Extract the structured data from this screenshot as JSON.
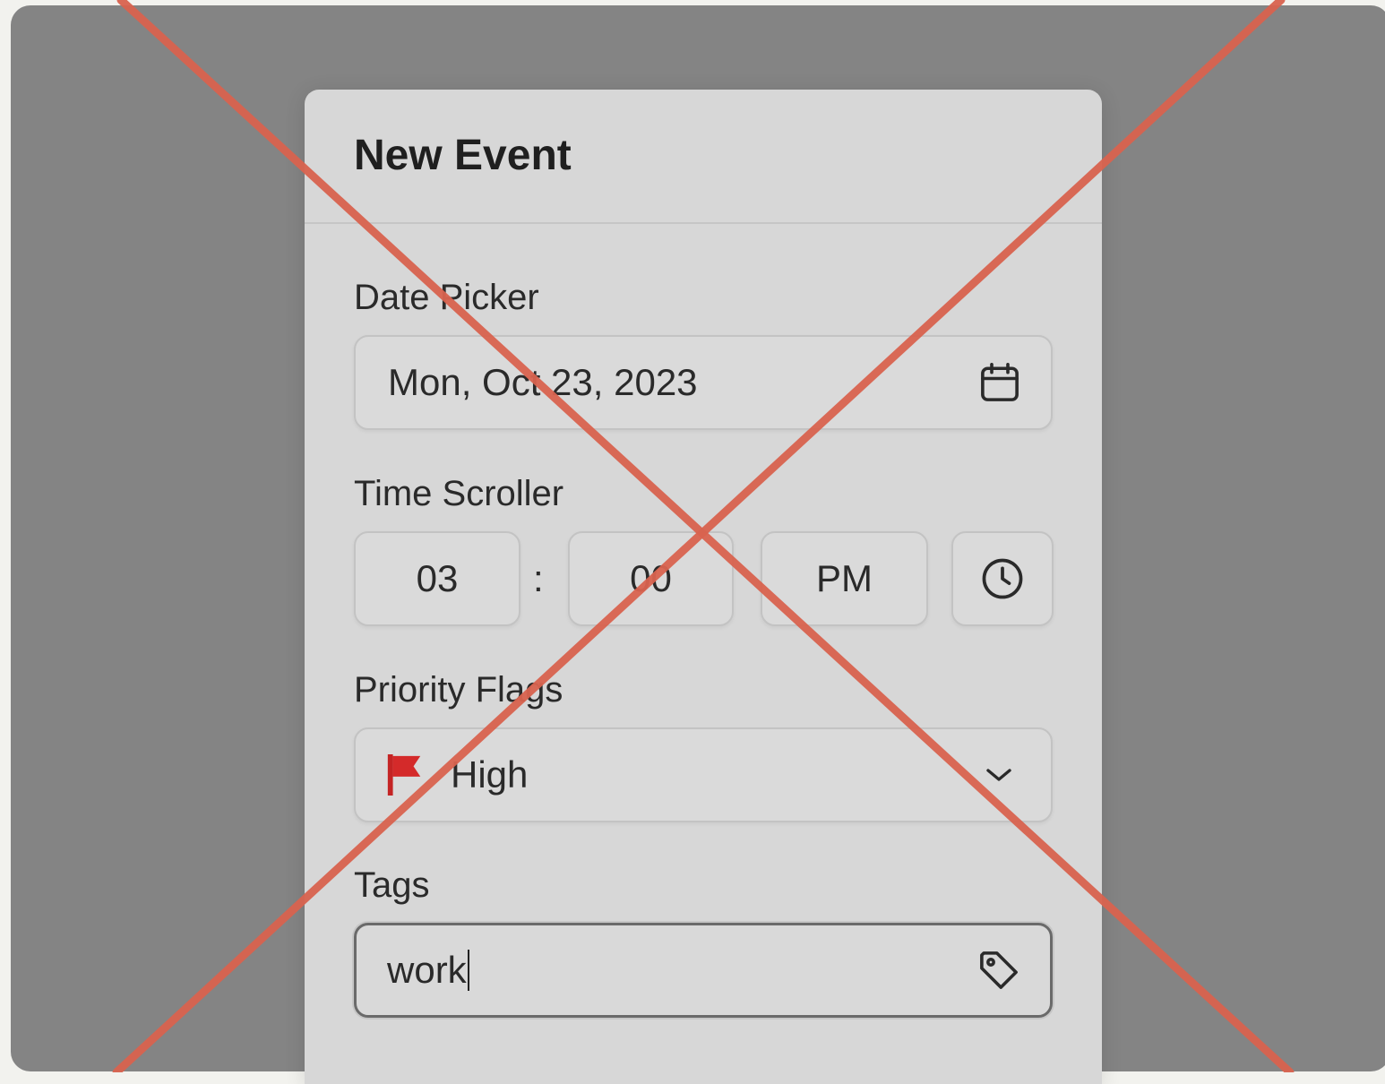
{
  "modal": {
    "title": "New Event"
  },
  "date_picker": {
    "label": "Date Picker",
    "value": "Mon, Oct 23, 2023",
    "icon": "calendar-icon"
  },
  "time_scroller": {
    "label": "Time Scroller",
    "hours": "03",
    "separator": ":",
    "minutes": "00",
    "period": "PM",
    "icon": "clock-icon"
  },
  "priority": {
    "label": "Priority Flags",
    "value": "High",
    "flag_color": "#d42a2a",
    "icon": "flag-icon",
    "dropdown_icon": "chevron-down-icon"
  },
  "tags": {
    "label": "Tags",
    "value": "work",
    "icon": "tag-icon"
  },
  "colors": {
    "backdrop": "#848484",
    "modal": "#d7d7d7",
    "cross_lines": "#d9634f"
  }
}
